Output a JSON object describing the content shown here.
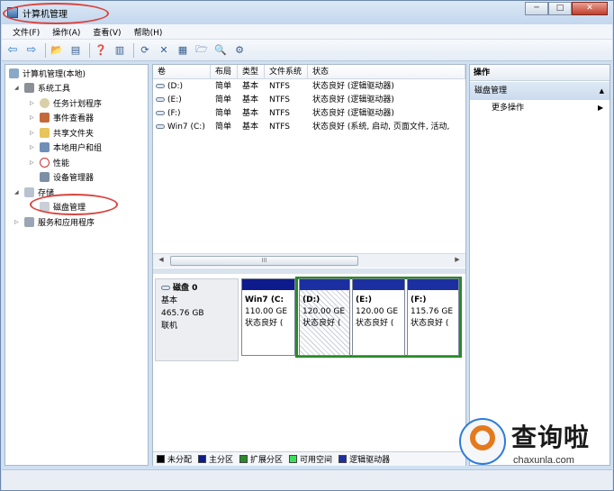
{
  "window": {
    "title": "计算机管理",
    "controls": {
      "minimize": "─",
      "maximize": "□",
      "close": "✕"
    }
  },
  "menu": [
    "文件(F)",
    "操作(A)",
    "查看(V)",
    "帮助(H)"
  ],
  "toolbar": [
    "back-icon",
    "forward-icon",
    "up-folder-icon",
    "show-hide-tree-icon",
    "help-icon",
    "show-action-pane-icon",
    "refresh-icon",
    "delete-icon",
    "properties-icon",
    "open-folder-icon",
    "search-icon",
    "settings-icon"
  ],
  "tree": {
    "root": "计算机管理(本地)",
    "system_tools": "系统工具",
    "task_scheduler": "任务计划程序",
    "event_viewer": "事件查看器",
    "shared_folders": "共享文件夹",
    "local_users": "本地用户和组",
    "performance": "性能",
    "device_manager": "设备管理器",
    "storage": "存储",
    "disk_management": "磁盘管理",
    "services": "服务和应用程序"
  },
  "volumes": {
    "columns": [
      "卷",
      "布局",
      "类型",
      "文件系统",
      "状态"
    ],
    "rows": [
      [
        "(D:)",
        "简单",
        "基本",
        "NTFS",
        "状态良好 (逻辑驱动器)"
      ],
      [
        "(E:)",
        "简单",
        "基本",
        "NTFS",
        "状态良好 (逻辑驱动器)"
      ],
      [
        "(F:)",
        "简单",
        "基本",
        "NTFS",
        "状态良好 (逻辑驱动器)"
      ],
      [
        "Win7 (C:)",
        "简单",
        "基本",
        "NTFS",
        "状态良好 (系统, 启动, 页面文件, 活动,"
      ]
    ],
    "scroll_thumb": "III"
  },
  "disk": {
    "name": "磁盘 0",
    "type": "基本",
    "size": "465.76 GB",
    "state": "联机",
    "partitions": [
      {
        "name": "Win7  (C:",
        "size": "110.00 GE",
        "status": "状态良好 (",
        "kind": "primary"
      },
      {
        "name": "(D:)",
        "size": "120.00 GE",
        "status": "状态良好 (",
        "kind": "logical-selected"
      },
      {
        "name": "(E:)",
        "size": "120.00 GE",
        "status": "状态良好 (",
        "kind": "logical"
      },
      {
        "name": "(F:)",
        "size": "115.76 GE",
        "status": "状态良好 (",
        "kind": "logical"
      }
    ]
  },
  "legend": [
    {
      "label": "未分配",
      "color": "#000000"
    },
    {
      "label": "主分区",
      "color": "#0d1b8c"
    },
    {
      "label": "扩展分区",
      "color": "#2a8a2a"
    },
    {
      "label": "可用空间",
      "color": "#3be05a"
    },
    {
      "label": "逻辑驱动器",
      "color": "#1c2fa1"
    }
  ],
  "actions": {
    "header": "操作",
    "section": "磁盘管理",
    "more": "更多操作"
  },
  "watermark": {
    "brand": "查询啦",
    "url": "chaxunla.com"
  }
}
